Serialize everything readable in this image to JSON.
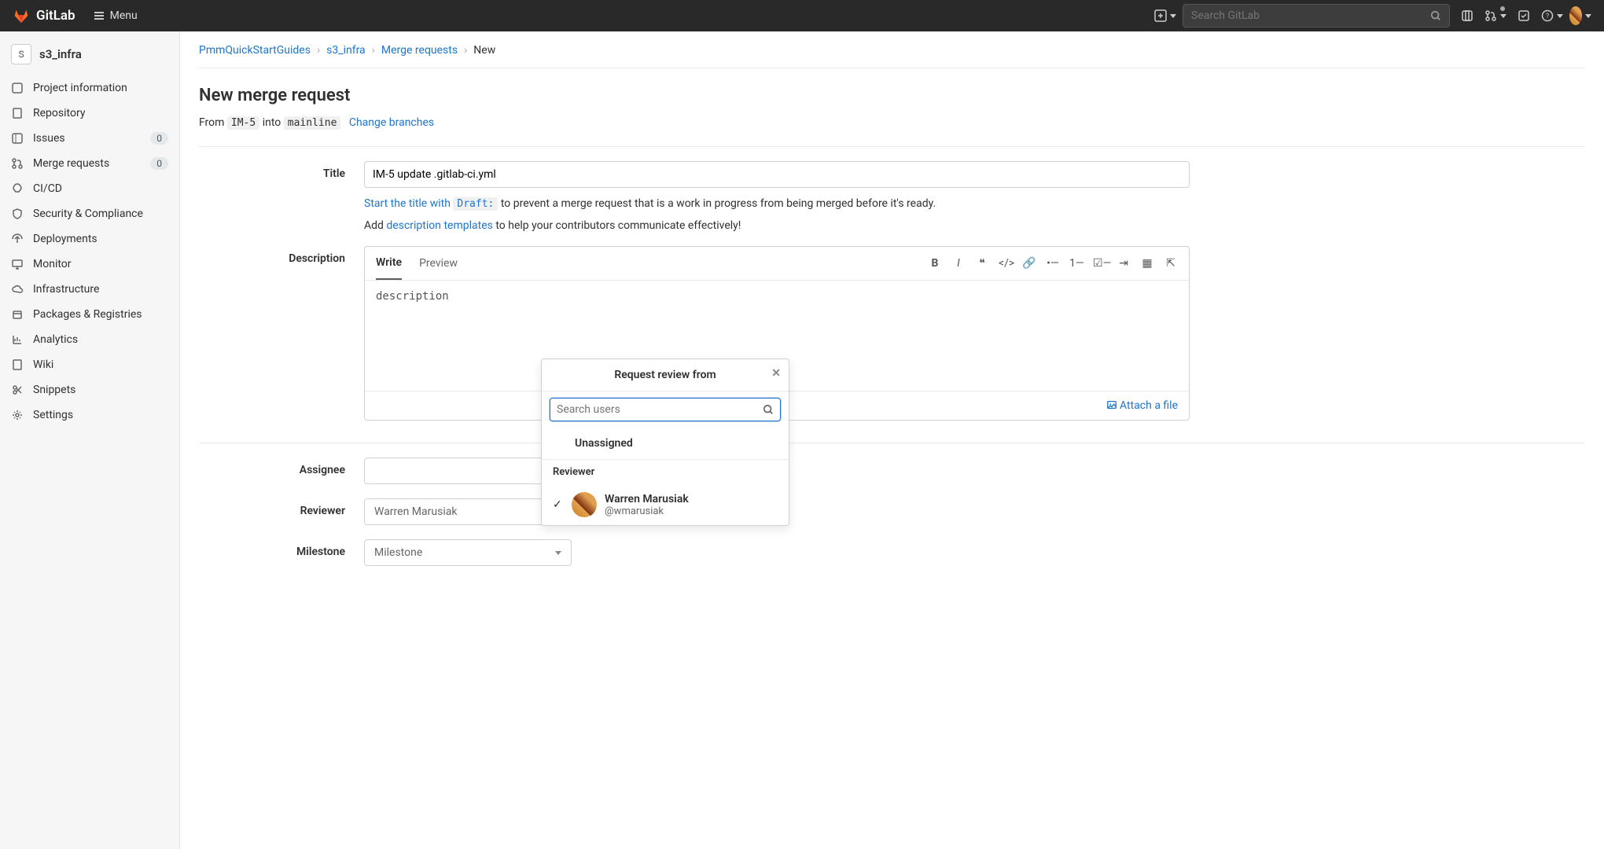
{
  "topbar": {
    "brand": "GitLab",
    "menu_label": "Menu",
    "search_placeholder": "Search GitLab"
  },
  "sidebar": {
    "project_initial": "S",
    "project_name": "s3_infra",
    "items": [
      {
        "label": "Project information"
      },
      {
        "label": "Repository"
      },
      {
        "label": "Issues",
        "badge": "0"
      },
      {
        "label": "Merge requests",
        "badge": "0"
      },
      {
        "label": "CI/CD"
      },
      {
        "label": "Security & Compliance"
      },
      {
        "label": "Deployments"
      },
      {
        "label": "Monitor"
      },
      {
        "label": "Infrastructure"
      },
      {
        "label": "Packages & Registries"
      },
      {
        "label": "Analytics"
      },
      {
        "label": "Wiki"
      },
      {
        "label": "Snippets"
      },
      {
        "label": "Settings"
      }
    ]
  },
  "breadcrumb": {
    "a": "PmmQuickStartGuides",
    "b": "s3_infra",
    "c": "Merge requests",
    "d": "New"
  },
  "page": {
    "heading": "New merge request",
    "from_word": "From",
    "src_branch": "IM-5",
    "into_word": "into",
    "dst_branch": "mainline",
    "change_branches": "Change branches"
  },
  "form": {
    "title_label": "Title",
    "title_value": "IM-5 update .gitlab-ci.yml",
    "draft_hint_pre": "Start the title with ",
    "draft_code": "Draft:",
    "draft_hint_post": " to prevent a merge request that is a work in progress from being merged before it's ready.",
    "tmpl_hint_pre": "Add ",
    "tmpl_link": "description templates",
    "tmpl_hint_post": " to help your contributors communicate effectively!",
    "desc_label": "Description",
    "write_tab": "Write",
    "preview_tab": "Preview",
    "desc_value": "description",
    "attach": "Attach a file",
    "assignee_label": "Assignee",
    "reviewer_label": "Reviewer",
    "reviewer_value": "Warren Marusiak",
    "milestone_label": "Milestone",
    "milestone_value": "Milestone"
  },
  "popover": {
    "title": "Request review from",
    "search_placeholder": "Search users",
    "unassigned": "Unassigned",
    "section": "Reviewer",
    "user_name": "Warren Marusiak",
    "user_handle": "@wmarusiak"
  }
}
